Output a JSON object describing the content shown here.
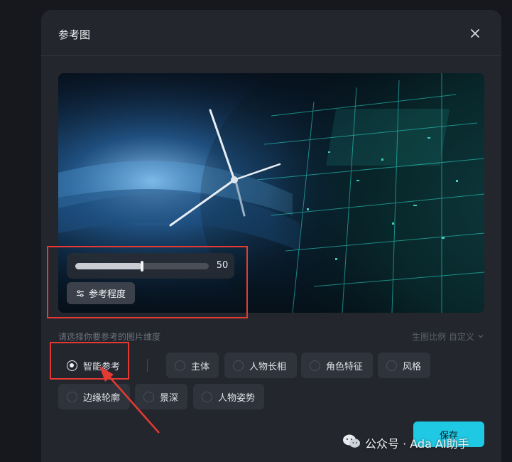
{
  "dialog": {
    "title": "参考图",
    "close_icon": "close-icon"
  },
  "preview": {
    "image": "wind-turbine-over-digital-earth",
    "slider": {
      "value": 50,
      "value_text": "50",
      "fill_fraction": 0.5
    },
    "degree_button": {
      "label": "参考程度",
      "icon": "sliders-icon"
    }
  },
  "dimension": {
    "hint": "请选择你要参考的图片维度",
    "ratio": {
      "label": "生图比例",
      "value": "自定义",
      "icon": "chevron-down-icon"
    },
    "options": [
      {
        "label": "智能参考",
        "selected": true
      },
      {
        "label": "主体",
        "selected": false
      },
      {
        "label": "人物长相",
        "selected": false
      },
      {
        "label": "角色特征",
        "selected": false
      },
      {
        "label": "风格",
        "selected": false
      },
      {
        "label": "边缘轮廓",
        "selected": false
      },
      {
        "label": "景深",
        "selected": false
      },
      {
        "label": "人物姿势",
        "selected": false
      }
    ]
  },
  "footer": {
    "save_label": "保存"
  },
  "watermark": {
    "text": "公众号 · Ada AI助手",
    "icon": "wechat-icon"
  },
  "colors": {
    "accent": "#1fc8e3",
    "annotation": "#e53a33",
    "dialog_bg": "#23262d"
  }
}
